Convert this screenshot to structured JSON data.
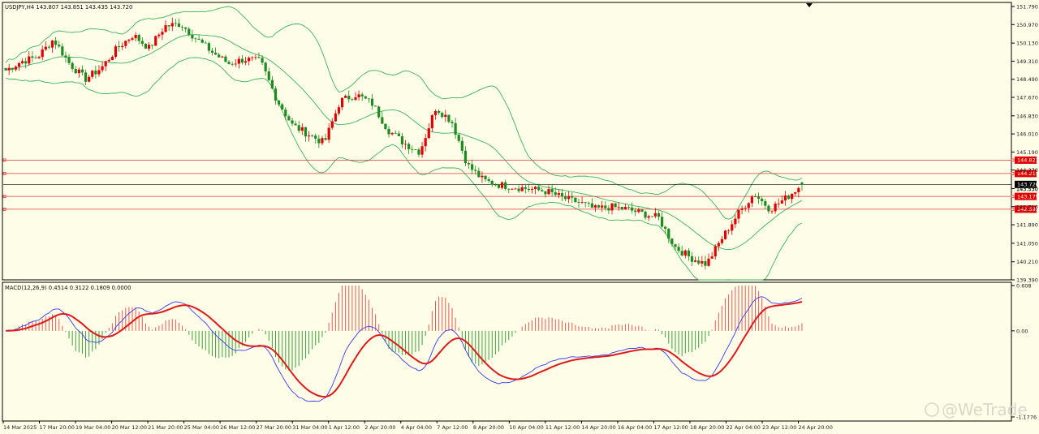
{
  "window": {
    "symbol_header": "USDJPY,H4  143.807 143.851 143.435 143.720",
    "macd_header": "MACD(12,26,9) 0.4514 0.3122 0.1809 0.0000",
    "watermark": "@WeTrade"
  },
  "colors": {
    "background": "#fdfde8",
    "bull": "#e00000",
    "bear": "#1f8a1f",
    "bands": "#3cb45c",
    "level_line": "#e33b3b",
    "price_line": "#000000",
    "macd_line": "#3a3af0",
    "signal_line": "#e01a1a",
    "hist_pos": "#e45a5a",
    "hist_neg": "#3ca03c"
  },
  "price_axis": {
    "labels": [
      "151.790",
      "150.970",
      "150.130",
      "149.310",
      "148.490",
      "147.670",
      "146.830",
      "146.010",
      "145.190",
      "144.370",
      "143.530",
      "142.710",
      "141.890",
      "141.050",
      "140.210",
      "139.390"
    ],
    "current_price": "143.720",
    "current_label_secondary": "143.530"
  },
  "levels": [
    {
      "price": 144.821,
      "label": "144.821"
    },
    {
      "price": 144.215,
      "label": "144.215"
    },
    {
      "price": 143.175,
      "label": "143.175"
    },
    {
      "price": 142.595,
      "label": "142.595"
    }
  ],
  "macd_axis": {
    "labels": [
      "0.608",
      "0.00",
      "-1.1776"
    ]
  },
  "time_axis": {
    "labels": [
      "14 Mar 2025",
      "17 Mar 20:00",
      "19 Mar 04:00",
      "20 Mar 12:00",
      "21 Mar 20:00",
      "25 Mar 04:00",
      "26 Mar 12:00",
      "27 Mar 20:00",
      "31 Mar 04:00",
      "1 Apr 12:00",
      "2 Apr 20:00",
      "4 Apr 04:00",
      "7 Apr 12:00",
      "8 Apr 20:00",
      "10 Apr 04:00",
      "11 Apr 12:00",
      "14 Apr 20:00",
      "16 Apr 04:00",
      "17 Apr 12:00",
      "18 Apr 20:00",
      "22 Apr 04:00",
      "23 Apr 12:00",
      "24 Apr 20:00"
    ]
  },
  "chart_data": [
    {
      "type": "candlestick",
      "title": "USDJPY,H4",
      "ylim": [
        139.39,
        151.79
      ],
      "overlays": [
        "Bollinger Bands",
        "Horizontal levels 144.821 / 144.215 / 143.175 / 142.595"
      ],
      "close_path": [
        148.9,
        149.3,
        149.5,
        150.3,
        149.2,
        148.5,
        149.0,
        149.9,
        150.5,
        149.9,
        150.9,
        151.0,
        150.3,
        149.7,
        149.2,
        149.4,
        149.3,
        147.6,
        146.4,
        146.0,
        145.6,
        147.5,
        147.8,
        147.4,
        146.2,
        145.6,
        145.2,
        147.2,
        146.6,
        144.6,
        143.9,
        143.7,
        143.6,
        143.5,
        143.4,
        143.1,
        142.9,
        142.6,
        142.7,
        142.6,
        142.4,
        142.2,
        140.9,
        140.4,
        140.1,
        141.3,
        142.4,
        143.3,
        142.6,
        143.1,
        143.72
      ],
      "last": {
        "open": 143.807,
        "high": 143.851,
        "low": 143.435,
        "close": 143.72
      }
    },
    {
      "type": "line",
      "title": "MACD(12,26,9)",
      "series": [
        {
          "name": "MACD",
          "values": [
            0.4514
          ]
        },
        {
          "name": "Signal",
          "values": [
            0.3122
          ]
        }
      ],
      "ylim": [
        -1.1776,
        0.608
      ]
    }
  ]
}
